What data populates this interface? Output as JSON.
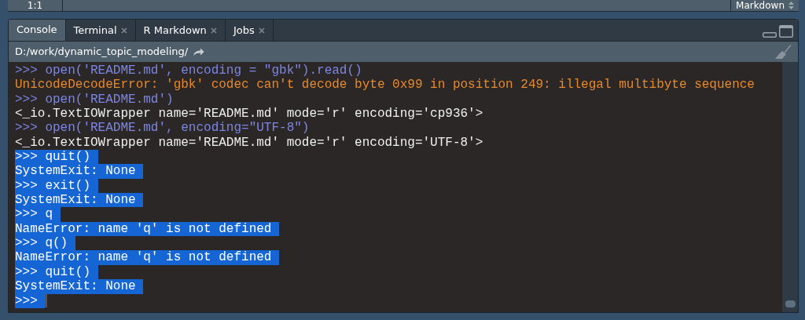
{
  "status_bar": {
    "position": "1:1",
    "file_type": "Markdown"
  },
  "tabs": [
    {
      "label": "Console",
      "selected": true,
      "closable": false
    },
    {
      "label": "Terminal",
      "selected": false,
      "closable": true
    },
    {
      "label": "R Markdown",
      "selected": false,
      "closable": true
    },
    {
      "label": "Jobs",
      "selected": false,
      "closable": true
    }
  ],
  "path": "D:/work/dynamic_topic_modeling/",
  "console_lines": [
    {
      "kind": "input",
      "text": ">>> open('README.md', encoding = \"gbk\").read()",
      "selected": false
    },
    {
      "kind": "error",
      "text": "UnicodeDecodeError: 'gbk' codec can't decode byte 0x99 in position 249: illegal multibyte sequence",
      "selected": false
    },
    {
      "kind": "input",
      "text": ">>> open('README.md')",
      "selected": false
    },
    {
      "kind": "output",
      "text": "<_io.TextIOWrapper name='README.md' mode='r' encoding='cp936'>",
      "selected": false
    },
    {
      "kind": "input",
      "text": ">>> open('README.md', encoding=\"UTF-8\")",
      "selected": false
    },
    {
      "kind": "output",
      "text": "<_io.TextIOWrapper name='README.md' mode='r' encoding='UTF-8'>",
      "selected": false
    },
    {
      "kind": "input",
      "text": ">>> quit()",
      "selected": true
    },
    {
      "kind": "output",
      "text": "SystemExit: None",
      "selected": true
    },
    {
      "kind": "input",
      "text": ">>> exit()",
      "selected": true
    },
    {
      "kind": "output",
      "text": "SystemExit: None",
      "selected": true
    },
    {
      "kind": "input",
      "text": ">>> q",
      "selected": true
    },
    {
      "kind": "output",
      "text": "NameError: name 'q' is not defined",
      "selected": true
    },
    {
      "kind": "input",
      "text": ">>> q()",
      "selected": true
    },
    {
      "kind": "output",
      "text": "NameError: name 'q' is not defined",
      "selected": true
    },
    {
      "kind": "input",
      "text": ">>> quit()",
      "selected": true
    },
    {
      "kind": "output",
      "text": "SystemExit: None",
      "selected": true
    },
    {
      "kind": "prompt",
      "text": ">>>",
      "selected": true
    }
  ]
}
